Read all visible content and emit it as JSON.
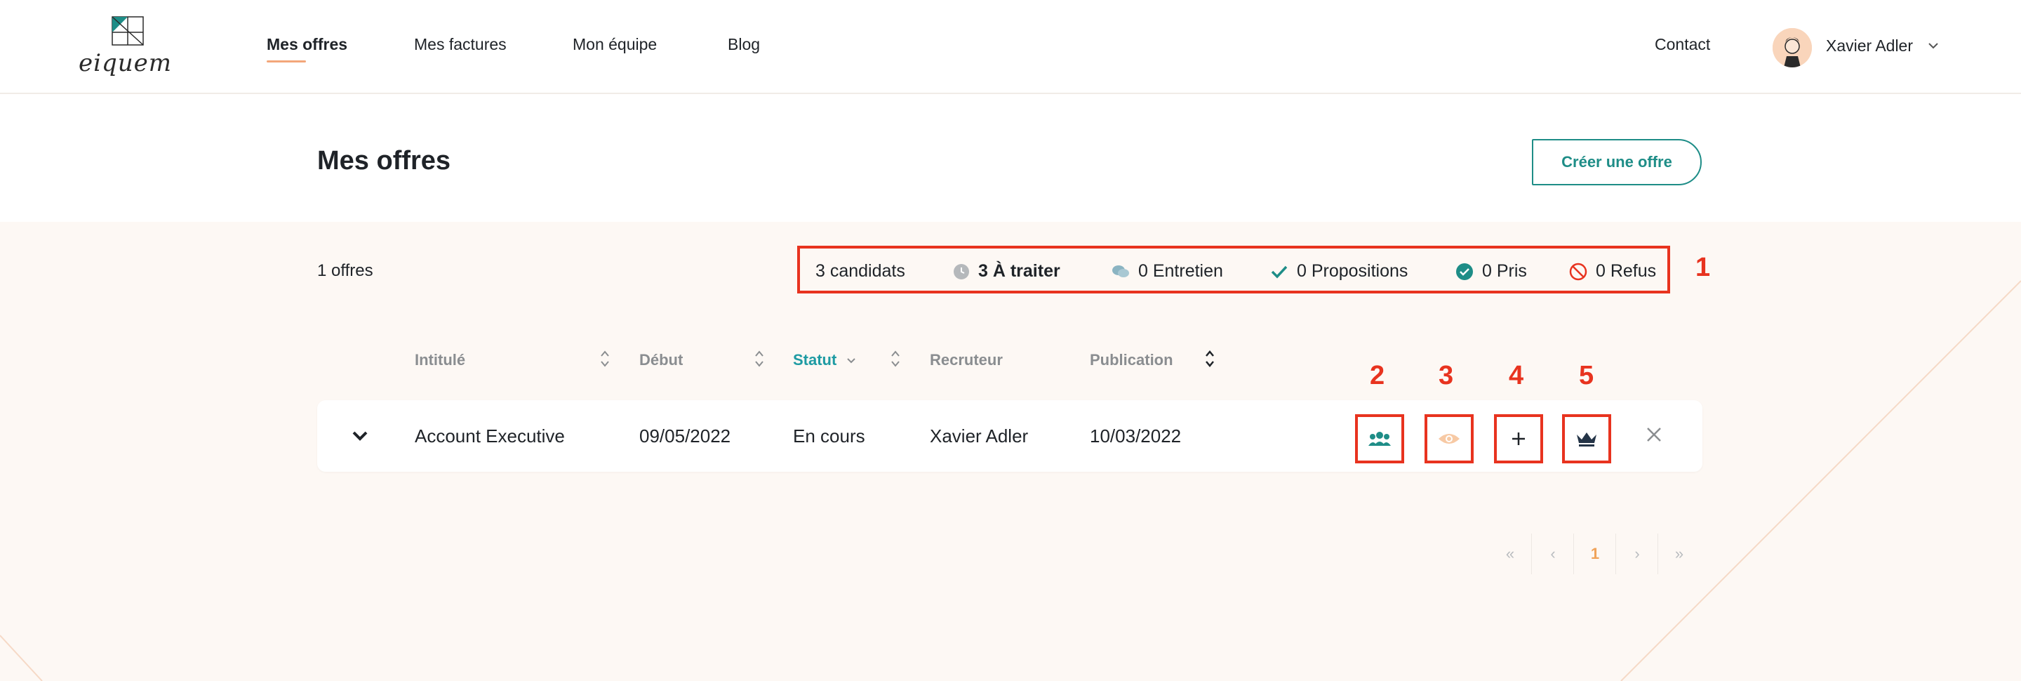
{
  "nav": {
    "logo_text": "eiquem",
    "links": [
      "Mes offres",
      "Mes factures",
      "Mon équipe",
      "Blog"
    ],
    "contact": "Contact",
    "user_name": "Xavier Adler"
  },
  "header": {
    "title": "Mes offres",
    "create_button": "Créer une offre"
  },
  "stats": {
    "offers_count": "1 offres",
    "candidats": "3 candidats",
    "a_traiter": "3 À traiter",
    "entretien": "0 Entretien",
    "propositions": "0 Propositions",
    "pris": "0 Pris",
    "refus": "0 Refus"
  },
  "annotations": [
    "1",
    "2",
    "3",
    "4",
    "5"
  ],
  "table": {
    "columns": [
      "Intitulé",
      "Début",
      "Statut",
      "Recruteur",
      "Publication"
    ],
    "rows": [
      {
        "intitule": "Account Executive",
        "debut": "09/05/2022",
        "statut": "En cours",
        "recruteur": "Xavier Adler",
        "publication": "10/03/2022"
      }
    ]
  },
  "pagination": [
    "«",
    "‹",
    "1",
    "›",
    "»"
  ],
  "colors": {
    "accent": "#1e8d87",
    "active_sort": "#1e9ba3",
    "annotation": "#e8331f",
    "underline": "#f3a77a",
    "background": "#fdf8f4"
  },
  "icons": {
    "a_traiter": "clock-icon",
    "entretien": "chat-icon",
    "propositions": "check-icon",
    "pris": "check-circle-icon",
    "refus": "forbidden-icon",
    "actions": [
      "users-icon",
      "eye-icon",
      "plus-icon",
      "crown-icon",
      "close-icon"
    ]
  }
}
